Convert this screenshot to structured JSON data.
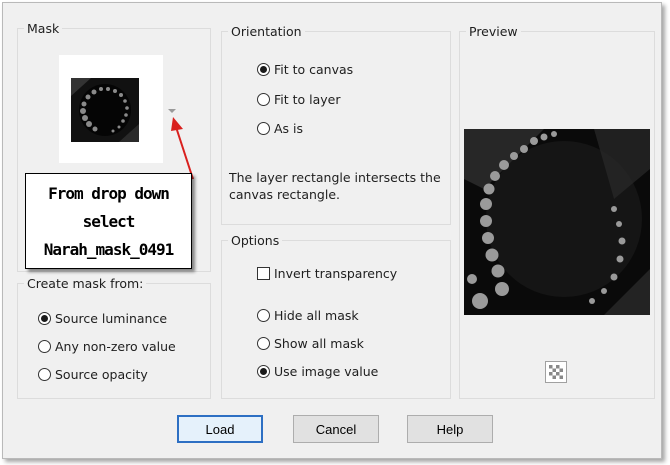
{
  "mask_group": {
    "title": "Mask"
  },
  "callout": {
    "lines": [
      "From drop down",
      "select",
      "Narah_mask_0491"
    ]
  },
  "create_mask_group": {
    "title": "Create mask from:",
    "options": [
      {
        "label": "Source luminance",
        "selected": true
      },
      {
        "label": "Any non-zero value",
        "selected": false
      },
      {
        "label": "Source opacity",
        "selected": false
      }
    ]
  },
  "orientation_group": {
    "title": "Orientation",
    "options": [
      {
        "label": "Fit to canvas",
        "selected": true
      },
      {
        "label": "Fit to layer",
        "selected": false
      },
      {
        "label": "As is",
        "selected": false
      }
    ],
    "note_line1": "The layer rectangle intersects the",
    "note_line2": "canvas rectangle."
  },
  "options_group": {
    "title": "Options",
    "invert_label": "Invert transparency",
    "invert_checked": false,
    "mask_options": [
      {
        "label": "Hide all mask",
        "selected": false
      },
      {
        "label": "Show all mask",
        "selected": false
      },
      {
        "label": "Use image value",
        "selected": true
      }
    ]
  },
  "preview_group": {
    "title": "Preview"
  },
  "buttons": {
    "load": "Load",
    "cancel": "Cancel",
    "help": "Help"
  },
  "colors": {
    "annotation_arrow": "#d9201e",
    "default_button_border": "#2d6fc3"
  }
}
